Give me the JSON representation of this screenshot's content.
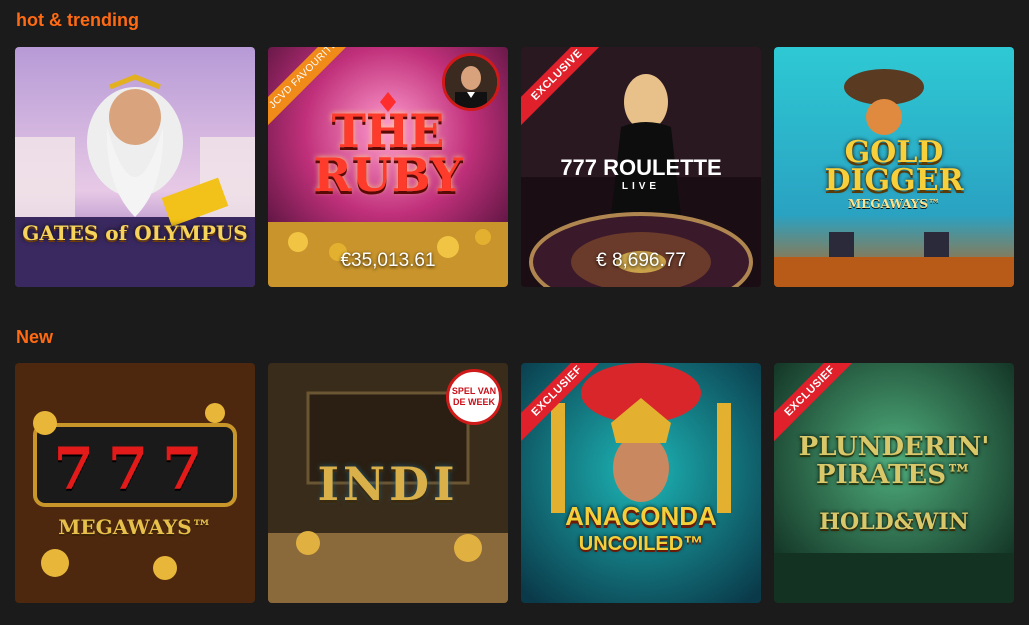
{
  "sections": [
    {
      "title": "hot & trending",
      "games": [
        {
          "logo": "GATES of OLYMPUS",
          "ribbon": "",
          "jackpot": ""
        },
        {
          "logo": "THE RUBY",
          "ribbon": "JCVD FAVOURITE",
          "jackpot": "€35,013.61"
        },
        {
          "logo": "777 ROULETTE",
          "logo_sub": "LIVE",
          "ribbon": "EXCLUSIVE",
          "jackpot": "€ 8,696.77"
        },
        {
          "logo": "GOLD DIGGER",
          "logo_sub": "MEGAWAYS™",
          "ribbon": "",
          "jackpot": ""
        }
      ]
    },
    {
      "title": "New",
      "games": [
        {
          "logo": "777",
          "logo_sub": "MEGAWAYS™",
          "ribbon": "",
          "badge": ""
        },
        {
          "logo": "INDI",
          "ribbon": "",
          "badge": "SPEL VAN DE WEEK"
        },
        {
          "logo": "ANACONDA",
          "logo_sub": "UNCOILED™",
          "ribbon": "EXCLUSIEF",
          "badge": ""
        },
        {
          "logo": "PLUNDERIN' PIRATES™",
          "logo_sub": "HOLD&WIN",
          "ribbon": "EXCLUSIEF",
          "badge": ""
        }
      ]
    }
  ],
  "colors": {
    "accent": "#ff6a13",
    "background": "#1b1b1b",
    "ribbon_red": "#e0202a",
    "ribbon_orange": "#f08a18"
  }
}
